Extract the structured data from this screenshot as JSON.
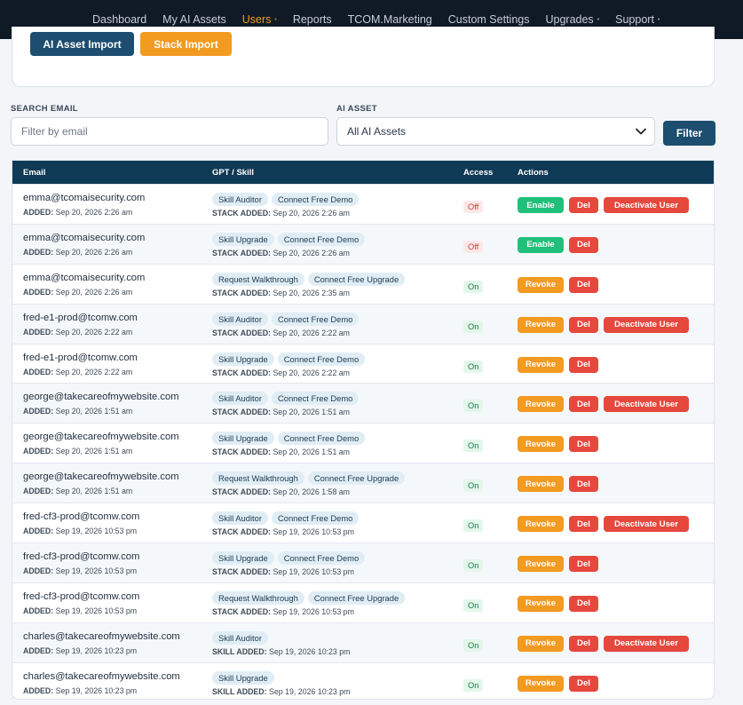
{
  "nav": {
    "items": [
      {
        "label": "Dashboard",
        "caret": false,
        "active": false
      },
      {
        "label": "My AI Assets",
        "caret": false,
        "active": false
      },
      {
        "label": "Users",
        "caret": true,
        "active": true
      },
      {
        "label": "Reports",
        "caret": false,
        "active": false
      },
      {
        "label": "TCOM.Marketing",
        "caret": false,
        "active": false
      },
      {
        "label": "Custom Settings",
        "caret": false,
        "active": false
      },
      {
        "label": "Upgrades",
        "caret": true,
        "active": false
      },
      {
        "label": "Support",
        "caret": true,
        "active": false
      }
    ]
  },
  "imports": {
    "ai_asset_label": "AI Asset Import",
    "stack_label": "Stack Import"
  },
  "filters": {
    "search_label": "SEARCH EMAIL",
    "search_placeholder": "Filter by email",
    "asset_label": "AI ASSET",
    "asset_selected": "All AI Assets",
    "filter_button": "Filter"
  },
  "table": {
    "headers": {
      "email": "Email",
      "gpt": "GPT / Skill",
      "access": "Access",
      "actions": "Actions"
    },
    "added_prefix": "ADDED:",
    "labels": {
      "enable": "Enable",
      "revoke": "Revoke",
      "del": "Del",
      "deactivate": "Deactivate User"
    },
    "rows": [
      {
        "email": "emma@tcomaisecurity.com",
        "added": "Sep 20, 2026 2:26 am",
        "pills": [
          "Skill Auditor",
          "Connect Free Demo"
        ],
        "sub_label": "STACK ADDED:",
        "sub_date": "Sep 20, 2026 2:26 am",
        "access": "Off",
        "primary": "enable",
        "deactivate": true
      },
      {
        "email": "emma@tcomaisecurity.com",
        "added": "Sep 20, 2026 2:26 am",
        "pills": [
          "Skill Upgrade",
          "Connect Free Demo"
        ],
        "sub_label": "STACK ADDED:",
        "sub_date": "Sep 20, 2026 2:26 am",
        "access": "Off",
        "primary": "enable",
        "deactivate": false
      },
      {
        "email": "emma@tcomaisecurity.com",
        "added": "Sep 20, 2026 2:26 am",
        "pills": [
          "Request Walkthrough",
          "Connect Free Upgrade"
        ],
        "sub_label": "STACK ADDED:",
        "sub_date": "Sep 20, 2026 2:35 am",
        "access": "On",
        "primary": "revoke",
        "deactivate": false
      },
      {
        "email": "fred-e1-prod@tcomw.com",
        "added": "Sep 20, 2026 2:22 am",
        "pills": [
          "Skill Auditor",
          "Connect Free Demo"
        ],
        "sub_label": "STACK ADDED:",
        "sub_date": "Sep 20, 2026 2:22 am",
        "access": "On",
        "primary": "revoke",
        "deactivate": true
      },
      {
        "email": "fred-e1-prod@tcomw.com",
        "added": "Sep 20, 2026 2:22 am",
        "pills": [
          "Skill Upgrade",
          "Connect Free Demo"
        ],
        "sub_label": "STACK ADDED:",
        "sub_date": "Sep 20, 2026 2:22 am",
        "access": "On",
        "primary": "revoke",
        "deactivate": false
      },
      {
        "email": "george@takecareofmywebsite.com",
        "added": "Sep 20, 2026 1:51 am",
        "pills": [
          "Skill Auditor",
          "Connect Free Demo"
        ],
        "sub_label": "STACK ADDED:",
        "sub_date": "Sep 20, 2026 1:51 am",
        "access": "On",
        "primary": "revoke",
        "deactivate": true
      },
      {
        "email": "george@takecareofmywebsite.com",
        "added": "Sep 20, 2026 1:51 am",
        "pills": [
          "Skill Upgrade",
          "Connect Free Demo"
        ],
        "sub_label": "STACK ADDED:",
        "sub_date": "Sep 20, 2026 1:51 am",
        "access": "On",
        "primary": "revoke",
        "deactivate": false
      },
      {
        "email": "george@takecareofmywebsite.com",
        "added": "Sep 20, 2026 1:51 am",
        "pills": [
          "Request Walkthrough",
          "Connect Free Upgrade"
        ],
        "sub_label": "STACK ADDED:",
        "sub_date": "Sep 20, 2026 1:58 am",
        "access": "On",
        "primary": "revoke",
        "deactivate": false
      },
      {
        "email": "fred-cf3-prod@tcomw.com",
        "added": "Sep 19, 2026 10:53 pm",
        "pills": [
          "Skill Auditor",
          "Connect Free Demo"
        ],
        "sub_label": "STACK ADDED:",
        "sub_date": "Sep 19, 2026 10:53 pm",
        "access": "On",
        "primary": "revoke",
        "deactivate": true
      },
      {
        "email": "fred-cf3-prod@tcomw.com",
        "added": "Sep 19, 2026 10:53 pm",
        "pills": [
          "Skill Upgrade",
          "Connect Free Demo"
        ],
        "sub_label": "STACK ADDED:",
        "sub_date": "Sep 19, 2026 10:53 pm",
        "access": "On",
        "primary": "revoke",
        "deactivate": false
      },
      {
        "email": "fred-cf3-prod@tcomw.com",
        "added": "Sep 19, 2026 10:53 pm",
        "pills": [
          "Request Walkthrough",
          "Connect Free Upgrade"
        ],
        "sub_label": "STACK ADDED:",
        "sub_date": "Sep 19, 2026 10:53 pm",
        "access": "On",
        "primary": "revoke",
        "deactivate": false
      },
      {
        "email": "charles@takecareofmywebsite.com",
        "added": "Sep 19, 2026 10:23 pm",
        "pills": [
          "Skill Auditor"
        ],
        "sub_label": "SKILL ADDED:",
        "sub_date": "Sep 19, 2026 10:23 pm",
        "access": "On",
        "primary": "revoke",
        "deactivate": true
      },
      {
        "email": "charles@takecareofmywebsite.com",
        "added": "Sep 19, 2026 10:23 pm",
        "pills": [
          "Skill Upgrade"
        ],
        "sub_label": "SKILL ADDED:",
        "sub_date": "Sep 19, 2026 10:23 pm",
        "access": "On",
        "primary": "revoke",
        "deactivate": false
      }
    ]
  }
}
